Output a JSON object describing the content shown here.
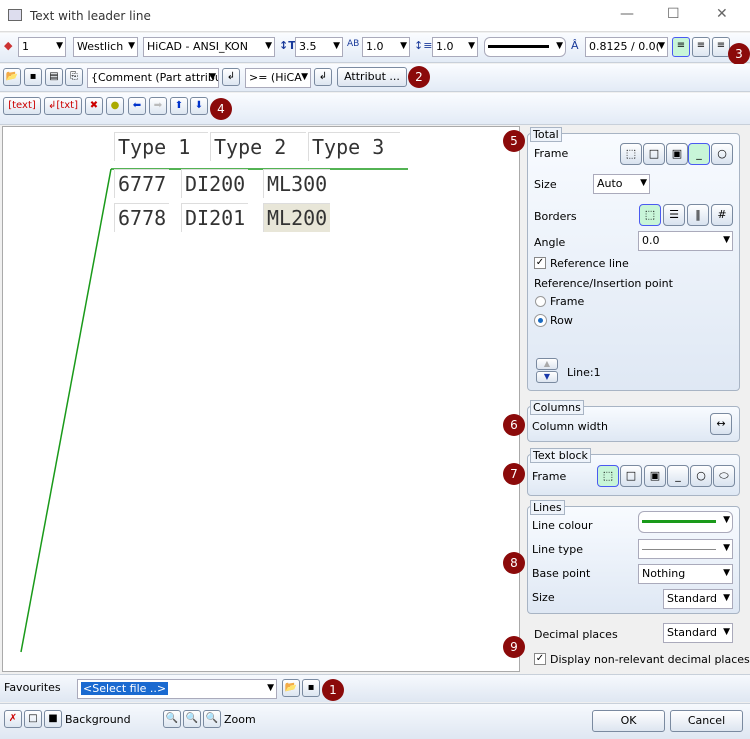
{
  "window": {
    "title": "Text with leader line"
  },
  "toolbar1": {
    "layer": "1",
    "font": "Westlich",
    "style": "HiCAD - ANSI_KON",
    "height": "3.5",
    "spacing": "1.0",
    "line_spacing": "1.0",
    "ratio": "0.8125 / 0.0("
  },
  "toolbar2": {
    "attribute_combo": "{Comment (Part attribu",
    "operator_combo": ">= (HiCA",
    "attribut_button": "Attribut ..."
  },
  "toolbar3": {
    "text_btn": "text",
    "txt_btn": "txt"
  },
  "table": {
    "headers": [
      "Type 1",
      "Type 2",
      "Type 3"
    ],
    "rows": [
      [
        "6777",
        "DI200",
        "ML300"
      ],
      [
        "6778",
        "DI201",
        "ML200"
      ]
    ]
  },
  "total": {
    "label": "Total",
    "frame": "Frame",
    "size": "Size",
    "size_value": "Auto",
    "borders": "Borders",
    "angle": "Angle",
    "angle_value": "0.0",
    "reference_line": "Reference line",
    "ref_point": "Reference/Insertion point",
    "opt_frame": "Frame",
    "opt_row": "Row",
    "line": "Line:1"
  },
  "columns": {
    "label": "Columns",
    "width": "Column width"
  },
  "text_block": {
    "label": "Text block",
    "frame": "Frame"
  },
  "lines": {
    "label": "Lines",
    "colour": "Line colour",
    "type": "Line type",
    "base_point": "Base point",
    "base_point_value": "Nothing",
    "size": "Size",
    "size_value": "Standard"
  },
  "decimal": {
    "label": "Decimal places",
    "value": "Standard",
    "display": "Display non-relevant decimal places"
  },
  "favourites": {
    "label": "Favourites",
    "placeholder": "<Select file ..>"
  },
  "footer": {
    "background": "Background",
    "zoom": "Zoom",
    "ok": "OK",
    "cancel": "Cancel"
  },
  "badges": [
    "1",
    "2",
    "3",
    "4",
    "5",
    "6",
    "7",
    "8",
    "9"
  ],
  "colors": {
    "leader_line": "#1a9a1a",
    "badge": "#8b0a0a"
  }
}
